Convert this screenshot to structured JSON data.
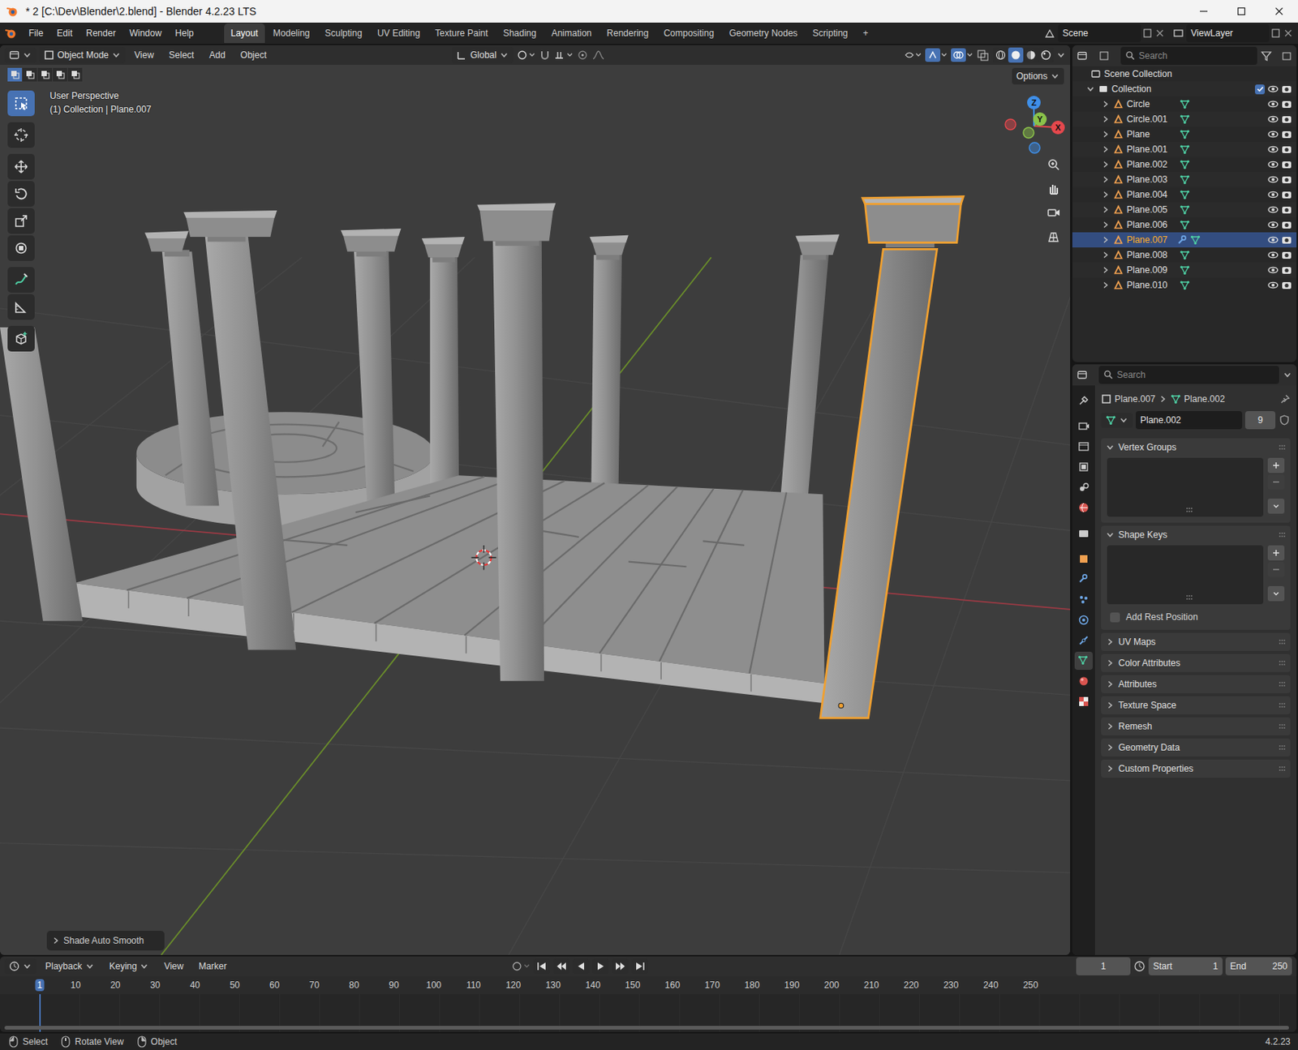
{
  "window": {
    "title": "* 2 [C:\\Dev\\Blender\\2.blend] - Blender 4.2.23 LTS"
  },
  "menus": [
    "File",
    "Edit",
    "Render",
    "Window",
    "Help"
  ],
  "workspaces": [
    {
      "label": "Layout",
      "selected": true
    },
    {
      "label": "Modeling",
      "selected": false
    },
    {
      "label": "Sculpting",
      "selected": false
    },
    {
      "label": "UV Editing",
      "selected": false
    },
    {
      "label": "Texture Paint",
      "selected": false
    },
    {
      "label": "Shading",
      "selected": false
    },
    {
      "label": "Animation",
      "selected": false
    },
    {
      "label": "Rendering",
      "selected": false
    },
    {
      "label": "Compositing",
      "selected": false
    },
    {
      "label": "Geometry Nodes",
      "selected": false
    },
    {
      "label": "Scripting",
      "selected": false
    }
  ],
  "add_workspace": "+",
  "scene": "Scene",
  "view_layer": "ViewLayer",
  "viewport": {
    "mode": "Object Mode",
    "menus": [
      "View",
      "Select",
      "Add",
      "Object"
    ],
    "orientation": "Global",
    "options": "Options",
    "perspective": "User Perspective",
    "context": "(1) Collection | Plane.007",
    "last_operator": "Shade Auto Smooth",
    "select_modes": [
      {
        "selected": true
      },
      {
        "selected": false
      },
      {
        "selected": false
      },
      {
        "selected": false
      },
      {
        "selected": false
      }
    ],
    "tools": [
      {
        "kind": "select",
        "selected": true
      },
      {
        "kind": "cursor",
        "selected": false
      },
      {
        "kind": "move",
        "selected": false
      },
      {
        "kind": "rotate",
        "selected": false
      },
      {
        "kind": "scale",
        "selected": false
      },
      {
        "kind": "transform",
        "selected": false
      },
      {
        "kind": "annotate",
        "selected": false
      },
      {
        "kind": "measure",
        "selected": false
      },
      {
        "kind": "add",
        "selected": false
      }
    ],
    "shading": [
      {
        "kind": "wireframe",
        "selected": false
      },
      {
        "kind": "solid",
        "selected": true
      },
      {
        "kind": "material",
        "selected": false
      },
      {
        "kind": "rendered",
        "selected": false
      }
    ],
    "gizmo": [
      {
        "label": "X",
        "color": "#e5484d"
      },
      {
        "label": "Y",
        "color": "#8bc34a"
      },
      {
        "label": "Z",
        "color": "#3f8fe8"
      }
    ]
  },
  "outliner": {
    "search": "Search",
    "root": "Scene Collection",
    "collection": "Collection",
    "collection_enabled": true,
    "items": [
      {
        "name": "Circle",
        "selected": false,
        "modifiers": false
      },
      {
        "name": "Circle.001",
        "selected": false,
        "modifiers": false
      },
      {
        "name": "Plane",
        "selected": false,
        "modifiers": false
      },
      {
        "name": "Plane.001",
        "selected": false,
        "modifiers": false
      },
      {
        "name": "Plane.002",
        "selected": false,
        "modifiers": false
      },
      {
        "name": "Plane.003",
        "selected": false,
        "modifiers": false
      },
      {
        "name": "Plane.004",
        "selected": false,
        "modifiers": false
      },
      {
        "name": "Plane.005",
        "selected": false,
        "modifiers": false
      },
      {
        "name": "Plane.006",
        "selected": false,
        "modifiers": false
      },
      {
        "name": "Plane.007",
        "selected": true,
        "modifiers": true
      },
      {
        "name": "Plane.008",
        "selected": false,
        "modifiers": false
      },
      {
        "name": "Plane.009",
        "selected": false,
        "modifiers": false
      },
      {
        "name": "Plane.010",
        "selected": false,
        "modifiers": false
      }
    ]
  },
  "properties": {
    "search": "Search",
    "object": "Plane.007",
    "data": "Plane.002",
    "mesh_name": "Plane.002",
    "users": "9",
    "tabs": [
      {
        "kind": "tool",
        "selected": false
      },
      {
        "kind": "render",
        "selected": false
      },
      {
        "kind": "output",
        "selected": false
      },
      {
        "kind": "viewlayer",
        "selected": false
      },
      {
        "kind": "scene",
        "selected": false
      },
      {
        "kind": "world",
        "selected": false
      },
      {
        "kind": "collection",
        "selected": false
      },
      {
        "kind": "object",
        "selected": false
      },
      {
        "kind": "modifier",
        "selected": false
      },
      {
        "kind": "particles",
        "selected": false
      },
      {
        "kind": "physics",
        "selected": false
      },
      {
        "kind": "constraint",
        "selected": false
      },
      {
        "kind": "data",
        "selected": true
      },
      {
        "kind": "material",
        "selected": false
      },
      {
        "kind": "texture",
        "selected": false
      }
    ],
    "sections": [
      {
        "label": "Vertex Groups",
        "expanded": true
      },
      {
        "label": "Shape Keys",
        "expanded": true,
        "option": {
          "label": "Add Rest Position",
          "checked": false
        }
      },
      {
        "label": "UV Maps",
        "expanded": false
      },
      {
        "label": "Color Attributes",
        "expanded": false
      },
      {
        "label": "Attributes",
        "expanded": false
      },
      {
        "label": "Texture Space",
        "expanded": false
      },
      {
        "label": "Remesh",
        "expanded": false
      },
      {
        "label": "Geometry Data",
        "expanded": false
      },
      {
        "label": "Custom Properties",
        "expanded": false
      }
    ]
  },
  "timeline": {
    "menus": [
      "Playback",
      "Keying",
      "View",
      "Marker"
    ],
    "frame": "1",
    "start_label": "Start",
    "start": "1",
    "end_label": "End",
    "end": "250",
    "ticks": [
      {
        "label": "1",
        "selected": true
      },
      {
        "label": "10",
        "selected": false
      },
      {
        "label": "20",
        "selected": false
      },
      {
        "label": "30",
        "selected": false
      },
      {
        "label": "40",
        "selected": false
      },
      {
        "label": "50",
        "selected": false
      },
      {
        "label": "60",
        "selected": false
      },
      {
        "label": "70",
        "selected": false
      },
      {
        "label": "80",
        "selected": false
      },
      {
        "label": "90",
        "selected": false
      },
      {
        "label": "100",
        "selected": false
      },
      {
        "label": "110",
        "selected": false
      },
      {
        "label": "120",
        "selected": false
      },
      {
        "label": "130",
        "selected": false
      },
      {
        "label": "140",
        "selected": false
      },
      {
        "label": "150",
        "selected": false
      },
      {
        "label": "160",
        "selected": false
      },
      {
        "label": "170",
        "selected": false
      },
      {
        "label": "180",
        "selected": false
      },
      {
        "label": "190",
        "selected": false
      },
      {
        "label": "200",
        "selected": false
      },
      {
        "label": "210",
        "selected": false
      },
      {
        "label": "220",
        "selected": false
      },
      {
        "label": "230",
        "selected": false
      },
      {
        "label": "240",
        "selected": false
      },
      {
        "label": "250",
        "selected": false
      }
    ]
  },
  "status": {
    "items": [
      "Select",
      "Rotate View",
      "Object"
    ],
    "version": "4.2.23"
  }
}
